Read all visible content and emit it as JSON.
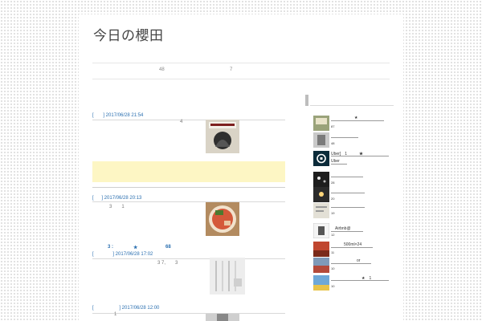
{
  "site": {
    "title": "今日の櫻田"
  },
  "header_meta": {
    "left": "48",
    "right": "7"
  },
  "posts": [
    {
      "date": "] 2017/06/28 21:54",
      "num": "4"
    },
    {
      "date": "] 2017/06/28 20:13",
      "num": "3　　1"
    },
    {
      "date": "] 2017/06/28 17:02",
      "num": "3 7,　　3"
    },
    {
      "date": "] 2017/06/28 12:00",
      "num": "1"
    }
  ],
  "post_bracket": "[",
  "teaser": {
    "prefix": "3 :",
    "star": "★",
    "count": "68"
  },
  "sidebar": {
    "items": [
      {
        "count": "87",
        "text": "★"
      },
      {
        "count": "48",
        "text": ""
      },
      {
        "count": "",
        "text": "Uber]　1　　　★",
        "sub": "Uber"
      },
      {
        "count": "28",
        "text": ""
      },
      {
        "count": "20",
        "text": ""
      },
      {
        "count": "19",
        "text": ""
      },
      {
        "count": "12",
        "text": "Airbnb@"
      },
      {
        "count": "11",
        "text": "500ml×24"
      },
      {
        "count": "10",
        "text": "or"
      },
      {
        "count": "10",
        "text": "★　1"
      }
    ]
  },
  "colors": {
    "accent": "#2a6fb0",
    "ad_bg": "#fdf6c4",
    "uber": "#0b2b3a"
  }
}
